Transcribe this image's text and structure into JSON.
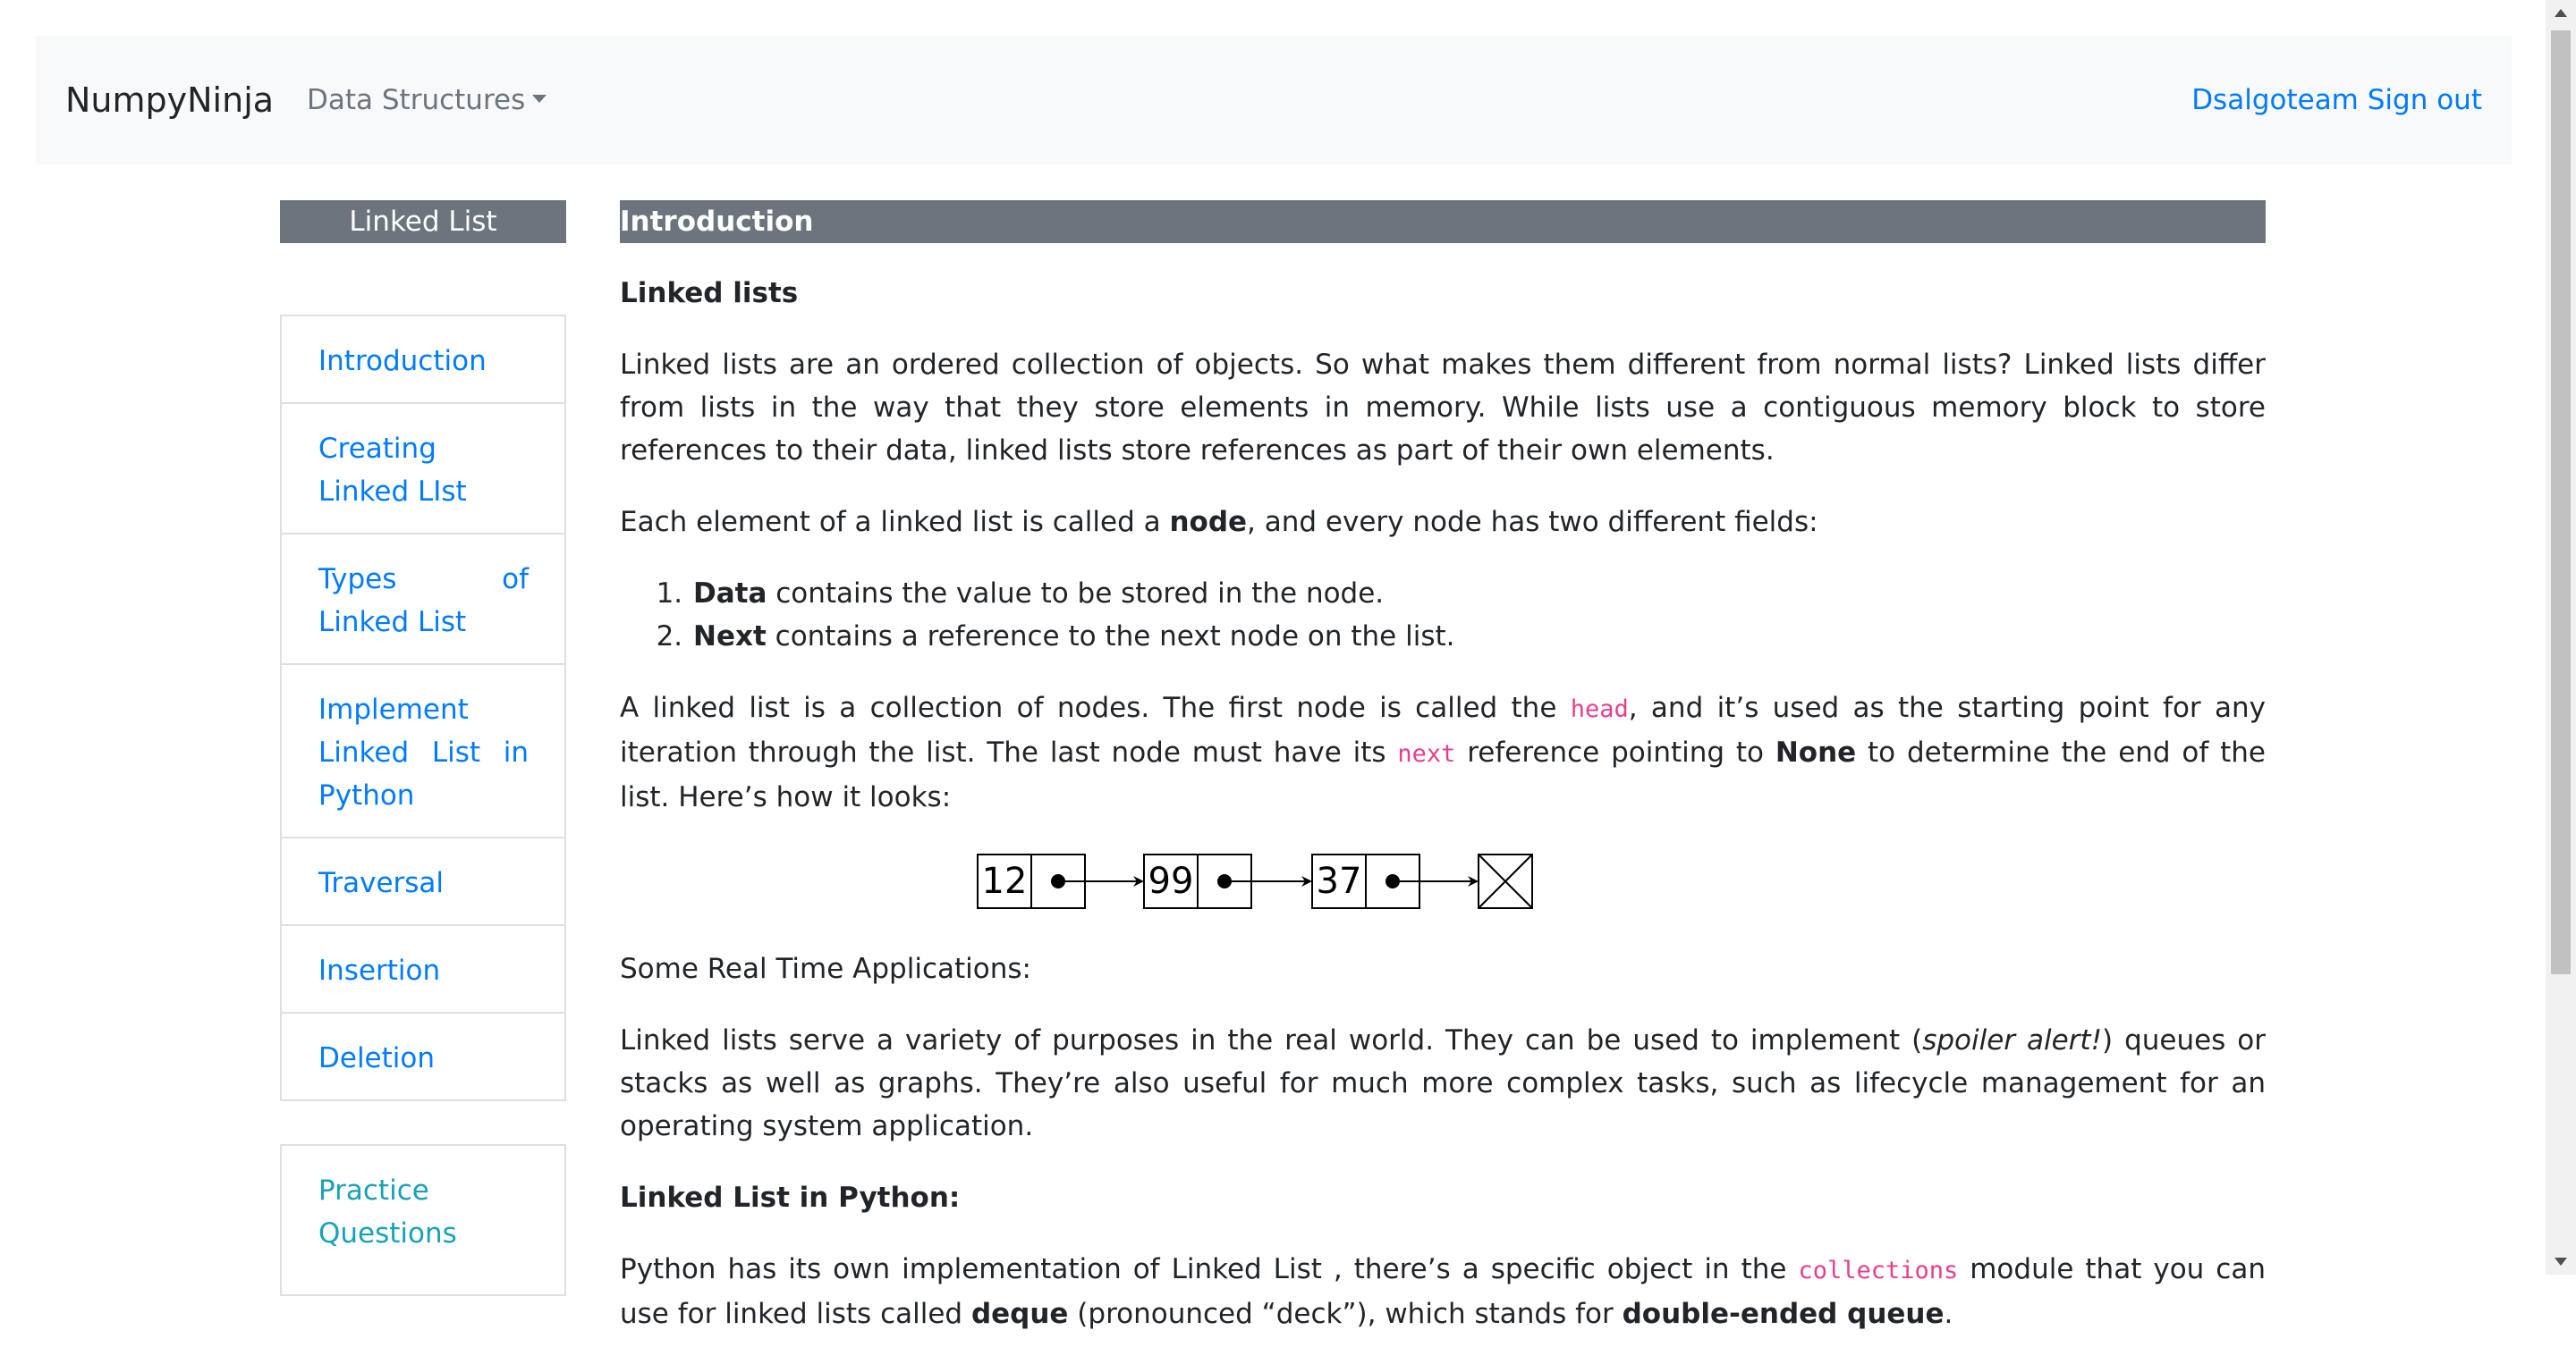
{
  "navbar": {
    "brand": "NumpyNinja",
    "data_structures_label": "Data Structures",
    "user_label": "Dsalgoteam",
    "signout_label": "Sign out"
  },
  "sidebar": {
    "title": "Linked List",
    "items": [
      {
        "label": "Introduction"
      },
      {
        "label": "Creating Linked LIst"
      },
      {
        "label": "Types of Linked List"
      },
      {
        "label": "Implement Linked List in Python"
      },
      {
        "label": "Traversal"
      },
      {
        "label": "Insertion"
      },
      {
        "label": "Deletion"
      }
    ],
    "practice_label": "Practice Questions"
  },
  "content": {
    "title": "Introduction",
    "heading1": "Linked lists",
    "p1": "Linked lists are an ordered collection of objects. So what makes them different from normal lists? Linked lists differ from lists in the way that they store elements in memory. While lists use a contiguous memory block to store references to their data, linked lists store references as part of their own elements.",
    "p2_a": "Each element of a linked list is called a ",
    "p2_b": "node",
    "p2_c": ", and every node has two different fields:",
    "list": [
      {
        "bold": "Data",
        "text": " contains the value to be stored in the node."
      },
      {
        "bold": "Next",
        "text": " contains a reference to the next node on the list."
      }
    ],
    "p3_a": "A linked list is a collection of nodes. The first node is called the ",
    "p3_code1": "head",
    "p3_b": ", and it’s used as the starting point for any iteration through the list. The last node must have its ",
    "p3_code2": "next",
    "p3_c": " reference pointing to ",
    "p3_bold": "None",
    "p3_d": " to determine the end of the list. Here’s how it looks:",
    "diagram_values": [
      "12",
      "99",
      "37"
    ],
    "p4": "Some Real Time Applications:",
    "p5_a": "Linked lists serve a variety of purposes in the real world. They can be used to implement (",
    "p5_em": "spoiler alert!",
    "p5_b": ") queues or stacks as well as graphs. They’re also useful for much more complex tasks, such as lifecycle management for an operating system application.",
    "heading2": "Linked List in Python:",
    "p6_a": "Python has its own implementation of Linked List , there’s a specific object in the ",
    "p6_code": "collections",
    "p6_b": " module that you can use for linked lists called ",
    "p6_bold1": "deque",
    "p6_c": " (pronounced “deck”), which stands for ",
    "p6_bold2": "double-ended queue",
    "p6_d": "."
  }
}
